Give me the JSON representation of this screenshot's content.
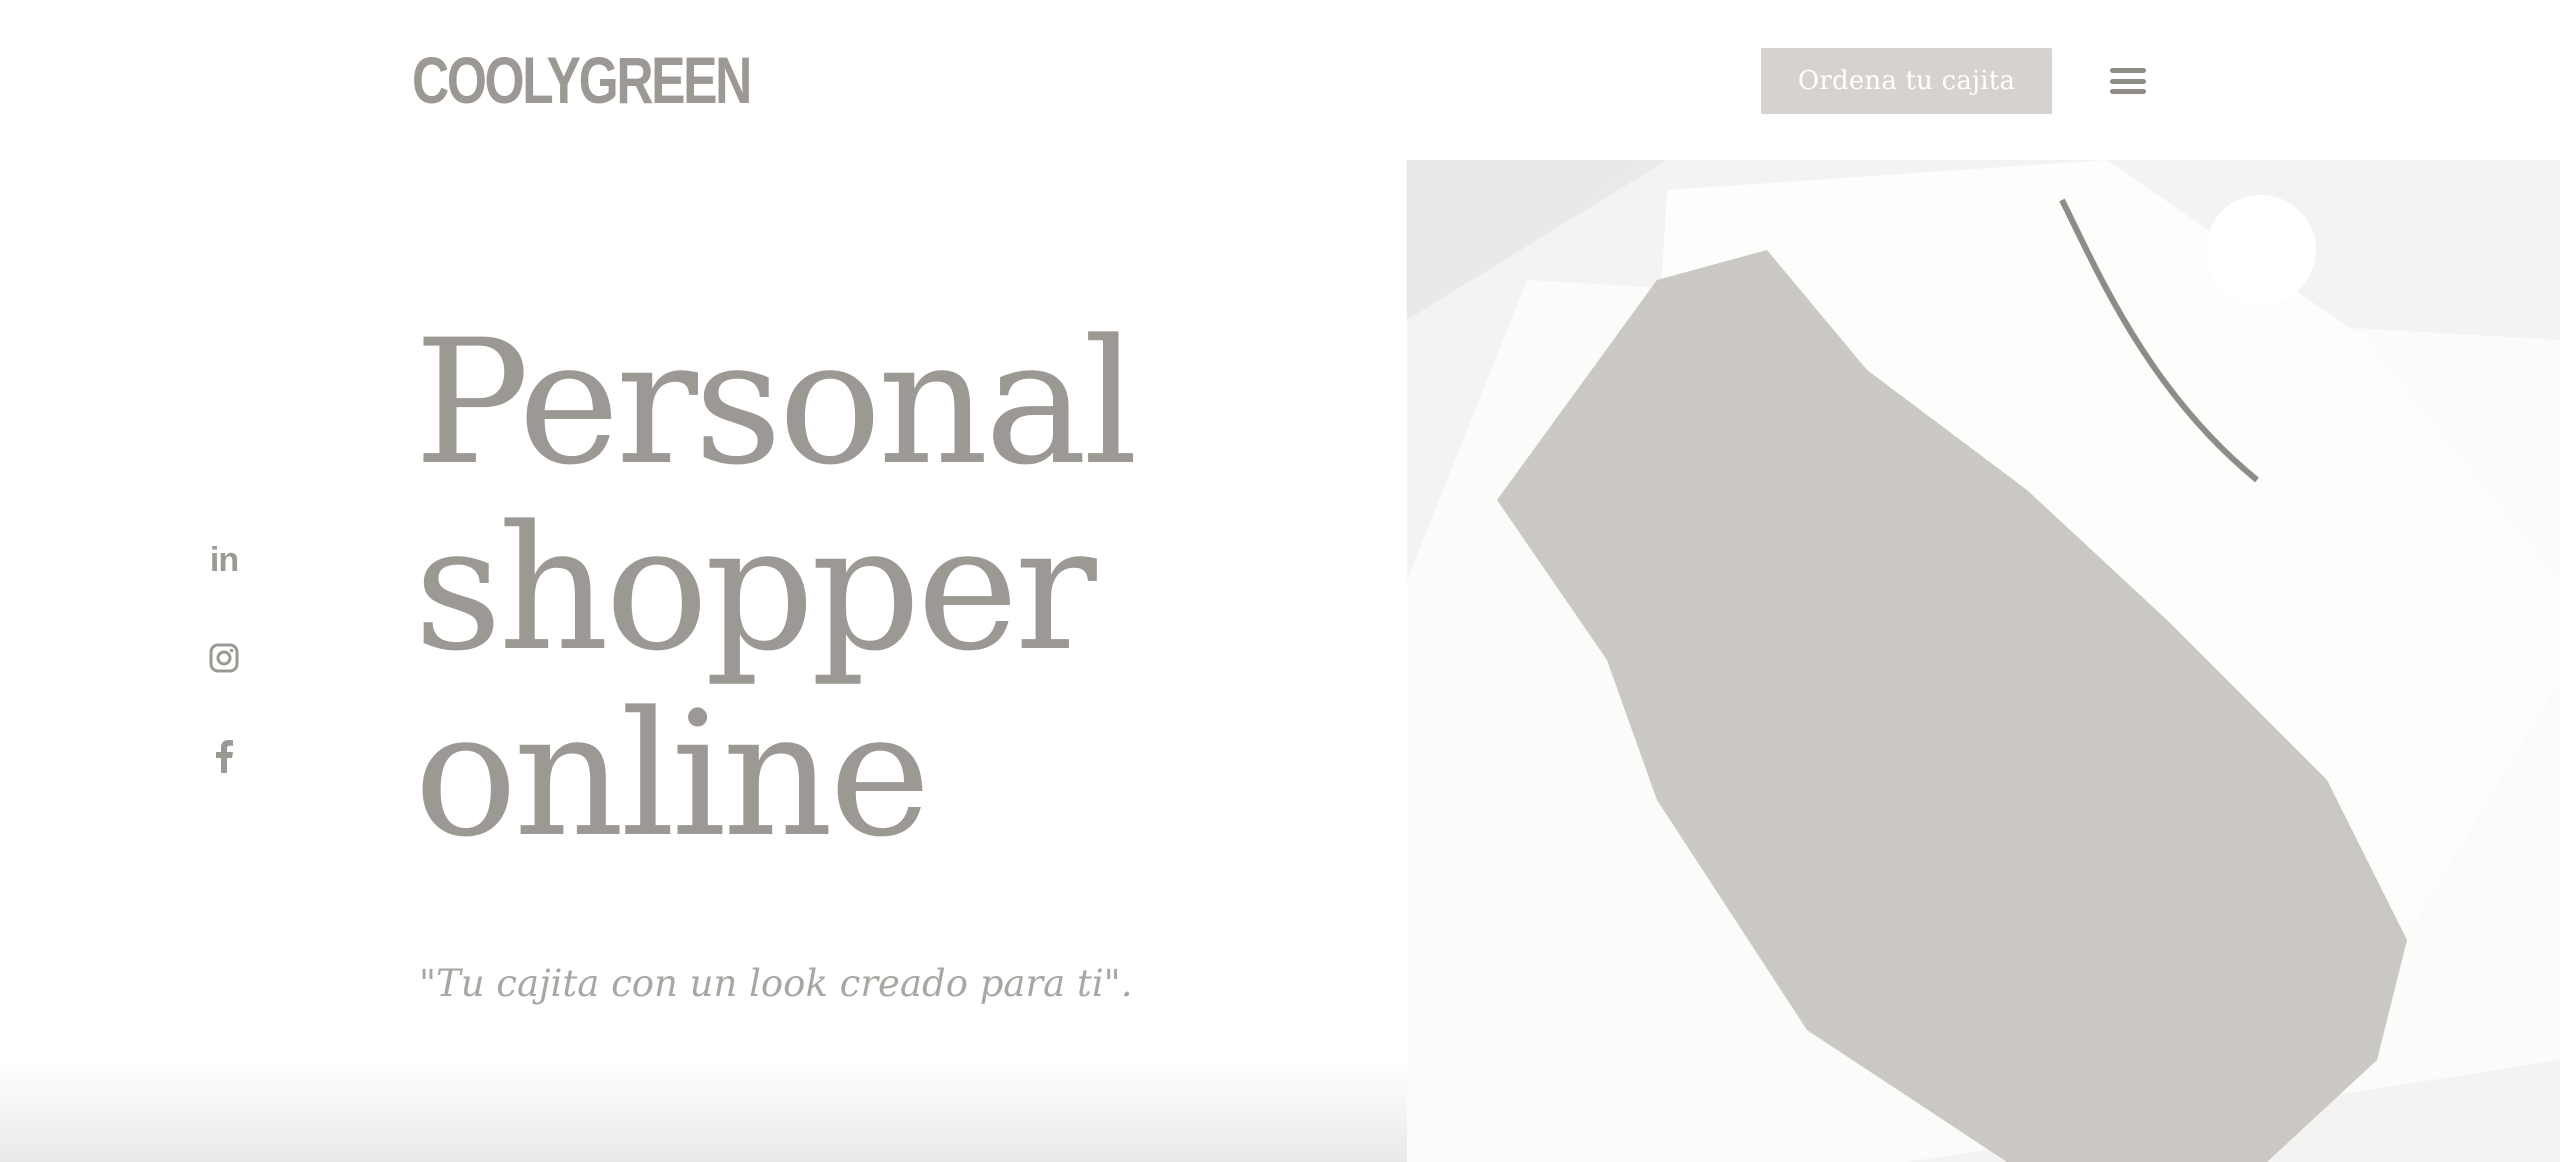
{
  "header": {
    "logo": "COOLYGREEN",
    "cta_label": "Ordena tu cajita",
    "menu_icon": "hamburger-menu-icon"
  },
  "social": [
    {
      "icon": "linkedin-icon",
      "label": "in"
    },
    {
      "icon": "instagram-icon"
    },
    {
      "icon": "facebook-icon"
    }
  ],
  "hero": {
    "title_lines": [
      "Personal",
      "shopper",
      "online"
    ],
    "tagline": "\"Tu cajita con un look creado para ti\"."
  },
  "colors": {
    "text": "#9c9893",
    "button_bg": "#d6d2cf",
    "background": "#ffffff"
  }
}
